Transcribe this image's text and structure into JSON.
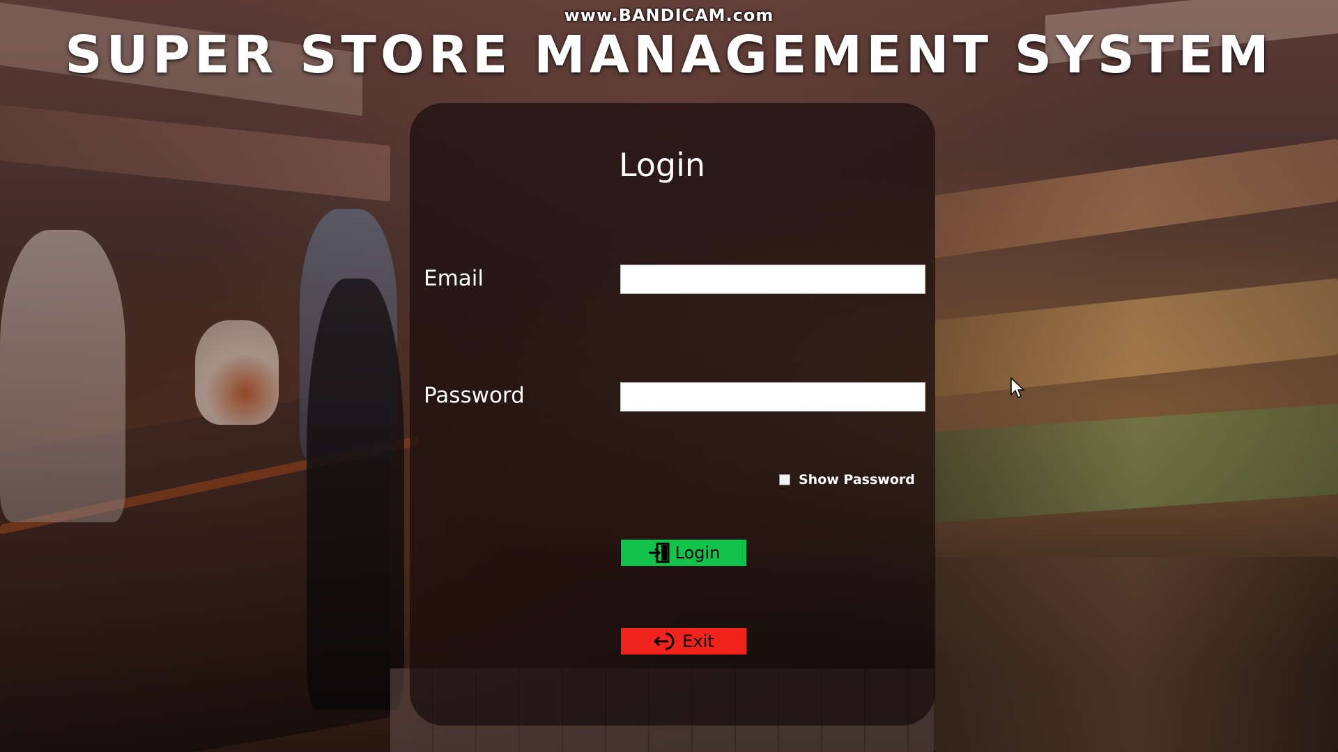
{
  "watermark": "www.BANDICAM.com",
  "app": {
    "title": "SUPER STORE MANAGEMENT SYSTEM"
  },
  "login_form": {
    "heading": "Login",
    "email_label": "Email",
    "email_value": "",
    "password_label": "Password",
    "password_value": "",
    "show_password_label": "Show Password",
    "show_password_checked": false,
    "login_button_label": "Login",
    "login_button_icon": "sign-in-icon",
    "exit_button_label": "Exit",
    "exit_button_icon": "sign-out-icon"
  },
  "colors": {
    "login_button": "#12c24a",
    "exit_button": "#f0241c",
    "panel": "rgba(20,10,10,0.68)"
  }
}
